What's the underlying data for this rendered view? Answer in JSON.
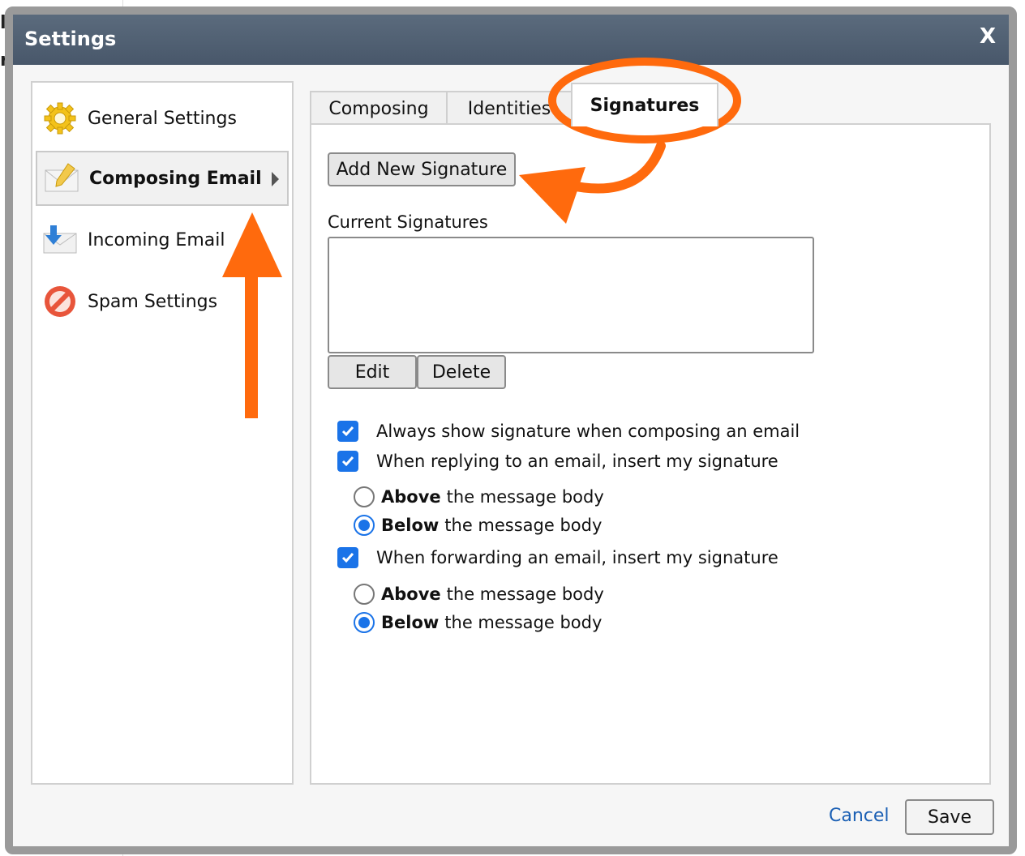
{
  "background": {
    "fragment_1": "la",
    "fragment_2": "ro"
  },
  "dialog": {
    "title": "Settings",
    "close_glyph": "X"
  },
  "sidebar": {
    "items": [
      {
        "label": "General Settings",
        "icon": "gear-icon",
        "selected": false
      },
      {
        "label": "Composing Email",
        "icon": "envelope-pencil-icon",
        "selected": true
      },
      {
        "label": "Incoming Email",
        "icon": "incoming-mail-icon",
        "selected": false
      },
      {
        "label": "Spam Settings",
        "icon": "no-entry-icon",
        "selected": false
      }
    ]
  },
  "tabs": [
    {
      "label": "Composing",
      "active": false
    },
    {
      "label": "Identities",
      "active": false
    },
    {
      "label": "Signatures",
      "active": true
    }
  ],
  "signatures": {
    "add_button": "Add New Signature",
    "list_label": "Current Signatures",
    "edit_button": "Edit",
    "delete_button": "Delete",
    "always_show": {
      "label": "Always show signature when composing an email",
      "checked": true
    },
    "reply": {
      "label": "When replying to an email, insert my signature",
      "checked": true,
      "above_bold": "Above",
      "above_rest": "the message body",
      "below_bold": "Below",
      "below_rest": "the message body",
      "selected": "below"
    },
    "forward": {
      "label": "When forwarding an email, insert my signature",
      "checked": true,
      "above_bold": "Above",
      "above_rest": "the message body",
      "below_bold": "Below",
      "below_rest": "the message body",
      "selected": "below"
    }
  },
  "footer": {
    "cancel": "Cancel",
    "save": "Save"
  },
  "colors": {
    "annotation": "#ff6a0d",
    "checkbox": "#1a73e8",
    "titlebar": "#4f5f72",
    "link": "#1a5fb4"
  }
}
